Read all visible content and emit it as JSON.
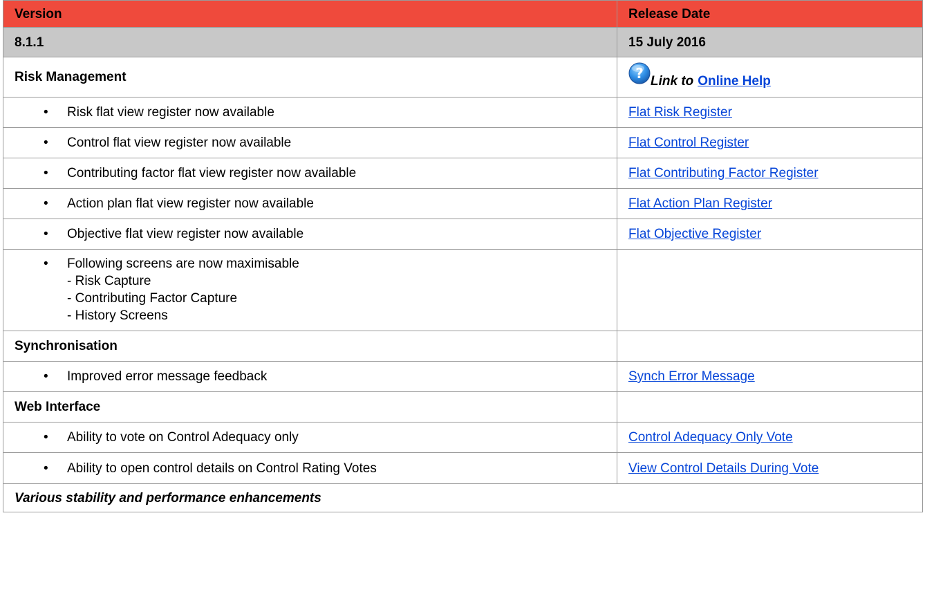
{
  "header": {
    "version_label": "Version",
    "release_date_label": "Release Date"
  },
  "release": {
    "version": "8.1.1",
    "date": "15 July 2016"
  },
  "risk_management": {
    "title": "Risk Management",
    "help_icon": "help-question-icon",
    "link_prefix": "Link to",
    "help_link": "Online Help",
    "items": [
      {
        "text": "Risk flat view register now available",
        "link": "Flat Risk Register"
      },
      {
        "text": "Control flat view register now available",
        "link": "Flat Control Register"
      },
      {
        "text": "Contributing factor flat view register now available",
        "link": "Flat Contributing Factor Register"
      },
      {
        "text": "Action plan flat view register now available",
        "link": "Flat Action Plan Register"
      },
      {
        "text": "Objective flat view register now available",
        "link": "Flat Objective Register"
      }
    ],
    "maximisable": {
      "text": "Following screens are now maximisable",
      "subs": [
        "- Risk Capture",
        "- Contributing Factor Capture",
        "- History Screens"
      ]
    }
  },
  "synchronisation": {
    "title": "Synchronisation",
    "items": [
      {
        "text": "Improved error message feedback",
        "link": "Synch Error Message"
      }
    ]
  },
  "web_interface": {
    "title": "Web Interface",
    "items": [
      {
        "text": "Ability to vote on Control Adequacy only",
        "link": "Control Adequacy Only Vote"
      },
      {
        "text": "Ability to open control details on Control Rating Votes",
        "link": "View Control Details During Vote"
      }
    ]
  },
  "footer": {
    "text": "Various stability and performance enhancements"
  },
  "colors": {
    "header_bg": "#ef4a3c",
    "version_bg": "#c8c8c8",
    "link": "#0645d8",
    "border": "#9a9a9a"
  }
}
